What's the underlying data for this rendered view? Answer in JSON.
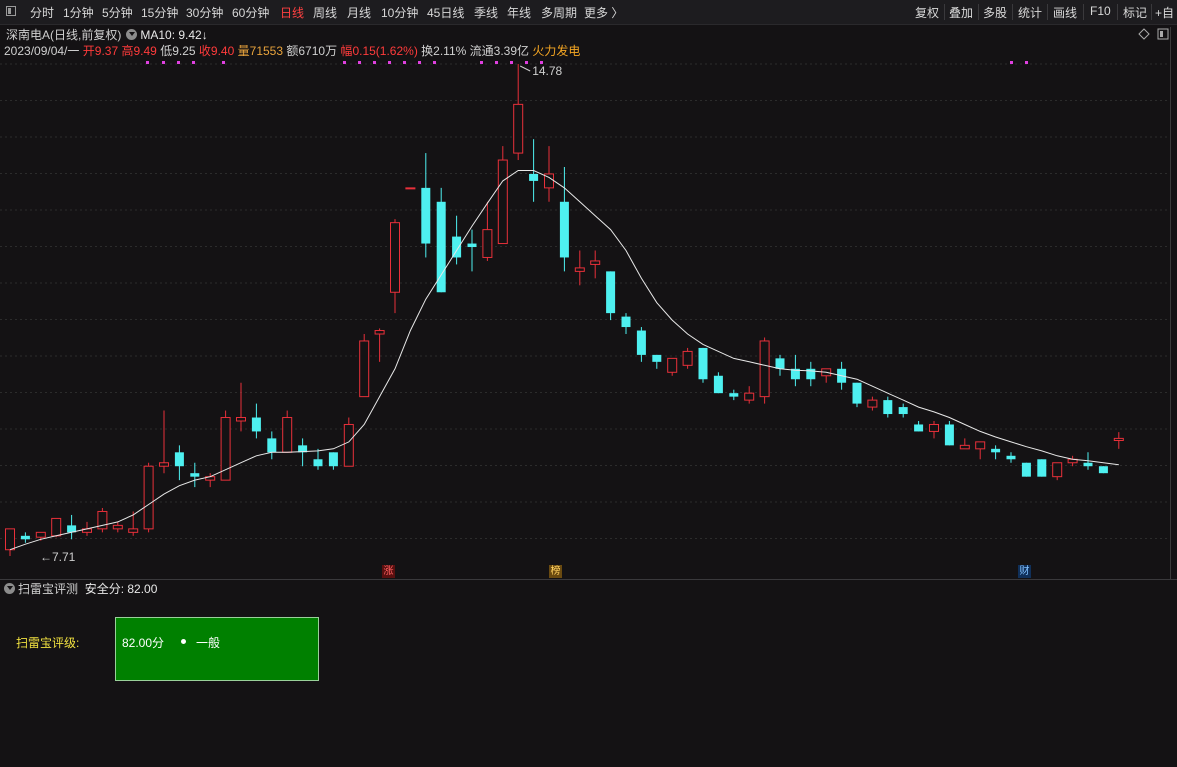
{
  "toolbar": {
    "periods": [
      "分时",
      "1分钟",
      "5分钟",
      "15分钟",
      "30分钟",
      "60分钟",
      "日线",
      "周线",
      "月线",
      "10分钟",
      "45日线",
      "季线",
      "年线",
      "多周期",
      "更多 〉"
    ],
    "active_period": "日线",
    "right_buttons": [
      "复权",
      "叠加",
      "多股",
      "统计",
      "画线",
      "F10",
      "标记",
      "+自"
    ]
  },
  "stock": {
    "name": "深南电A",
    "mode": "(日线,前复权)",
    "ma_label": "MA10:",
    "ma_value": "9.42",
    "ma_arrow": "↓",
    "date": "2023/09/04/一",
    "open_label": "开",
    "open": "9.37",
    "high_label": "高",
    "high": "9.49",
    "low_label": "低",
    "low": "9.25",
    "close_label": "收",
    "close": "9.40",
    "vol_label": "量",
    "vol": "71553",
    "amount_label": "额",
    "amount": "6710万",
    "range_label": "幅",
    "range": "0.15(1.62%)",
    "turnover_label": "换",
    "turnover": "2.11%",
    "float_label": "流通",
    "float_cap": "3.39亿",
    "sector": "火力发电"
  },
  "chart_data": {
    "type": "candlestick",
    "candles": [
      [
        7.8,
        8.1,
        7.71,
        8.05
      ],
      [
        8.0,
        7.95,
        7.9,
        8.05
      ],
      [
        7.98,
        8.05,
        7.93,
        8.0
      ],
      [
        8.0,
        8.25,
        7.98,
        8.18
      ],
      [
        8.15,
        8.05,
        7.95,
        8.3
      ],
      [
        8.05,
        8.1,
        8.0,
        8.2
      ],
      [
        8.1,
        8.35,
        8.05,
        8.4
      ],
      [
        8.1,
        8.15,
        8.05,
        8.2
      ],
      [
        8.05,
        8.1,
        8.0,
        8.35
      ],
      [
        8.1,
        9.0,
        8.05,
        9.05
      ],
      [
        9.0,
        9.05,
        8.9,
        9.8
      ],
      [
        9.2,
        9.0,
        8.8,
        9.3
      ],
      [
        8.9,
        8.85,
        8.7,
        9.05
      ],
      [
        8.8,
        8.85,
        8.7,
        8.9
      ],
      [
        8.8,
        9.7,
        8.8,
        9.8
      ],
      [
        9.65,
        9.7,
        9.5,
        10.2
      ],
      [
        9.7,
        9.5,
        9.4,
        9.9
      ],
      [
        9.4,
        9.2,
        9.1,
        9.5
      ],
      [
        9.2,
        9.7,
        9.2,
        9.8
      ],
      [
        9.3,
        9.2,
        9.0,
        9.4
      ],
      [
        9.1,
        9.0,
        8.95,
        9.25
      ],
      [
        9.2,
        9.0,
        8.95,
        9.2
      ],
      [
        9.0,
        9.6,
        9.0,
        9.7
      ],
      [
        10.0,
        10.8,
        10.0,
        10.9
      ],
      [
        10.9,
        10.95,
        10.5,
        10.98
      ],
      [
        11.5,
        12.5,
        11.2,
        12.55
      ],
      [
        13.0,
        13.0,
        13.0,
        13.0
      ],
      [
        13.0,
        12.2,
        12.0,
        13.5
      ],
      [
        12.8,
        11.5,
        11.5,
        13.0
      ],
      [
        12.3,
        12.0,
        11.9,
        12.6
      ],
      [
        12.2,
        12.15,
        11.8,
        12.4
      ],
      [
        12.0,
        12.4,
        11.95,
        12.8
      ],
      [
        12.2,
        13.4,
        12.2,
        13.6
      ],
      [
        13.5,
        14.2,
        13.4,
        14.78
      ],
      [
        13.2,
        13.1,
        12.8,
        13.7
      ],
      [
        13.0,
        13.2,
        12.8,
        13.6
      ],
      [
        12.8,
        12.0,
        11.8,
        13.3
      ],
      [
        11.8,
        11.85,
        11.6,
        12.1
      ],
      [
        11.9,
        11.95,
        11.7,
        12.1
      ],
      [
        11.8,
        11.2,
        11.1,
        11.8
      ],
      [
        11.15,
        11.0,
        10.9,
        11.2
      ],
      [
        10.95,
        10.6,
        10.5,
        11.0
      ],
      [
        10.6,
        10.5,
        10.4,
        10.6
      ],
      [
        10.35,
        10.55,
        10.3,
        10.55
      ],
      [
        10.45,
        10.65,
        10.4,
        10.7
      ],
      [
        10.7,
        10.25,
        10.2,
        10.7
      ],
      [
        10.3,
        10.05,
        10.05,
        10.35
      ],
      [
        10.05,
        10.0,
        9.95,
        10.1
      ],
      [
        9.95,
        10.05,
        9.9,
        10.15
      ],
      [
        10.0,
        10.8,
        9.9,
        10.85
      ],
      [
        10.55,
        10.4,
        10.3,
        10.6
      ],
      [
        10.4,
        10.25,
        10.15,
        10.6
      ],
      [
        10.4,
        10.25,
        10.15,
        10.5
      ],
      [
        10.3,
        10.4,
        10.2,
        10.4
      ],
      [
        10.4,
        10.2,
        10.1,
        10.5
      ],
      [
        10.2,
        9.9,
        9.85,
        10.2
      ],
      [
        9.85,
        9.95,
        9.8,
        10.0
      ],
      [
        9.95,
        9.75,
        9.7,
        10.0
      ],
      [
        9.85,
        9.75,
        9.7,
        9.9
      ],
      [
        9.6,
        9.5,
        9.5,
        9.65
      ],
      [
        9.5,
        9.6,
        9.4,
        9.65
      ],
      [
        9.6,
        9.3,
        9.3,
        9.65
      ],
      [
        9.25,
        9.3,
        9.25,
        9.4
      ],
      [
        9.25,
        9.35,
        9.1,
        9.35
      ],
      [
        9.25,
        9.2,
        9.1,
        9.3
      ],
      [
        9.15,
        9.1,
        9.05,
        9.2
      ],
      [
        9.05,
        8.85,
        8.85,
        9.05
      ],
      [
        9.1,
        8.85,
        8.85,
        9.1
      ],
      [
        8.85,
        9.05,
        8.8,
        9.05
      ],
      [
        9.05,
        9.1,
        9.0,
        9.15
      ],
      [
        9.05,
        9.0,
        8.95,
        9.2
      ],
      [
        9.0,
        8.9,
        8.9,
        9.0
      ],
      [
        9.37,
        9.4,
        9.25,
        9.49
      ]
    ],
    "ma10": [
      7.8,
      7.88,
      7.95,
      8.0,
      8.05,
      8.1,
      8.15,
      8.2,
      8.3,
      8.45,
      8.6,
      8.72,
      8.8,
      8.85,
      8.95,
      9.05,
      9.15,
      9.2,
      9.2,
      9.21,
      9.22,
      9.25,
      9.35,
      9.6,
      10.0,
      10.4,
      10.95,
      11.4,
      11.75,
      12.1,
      12.45,
      12.78,
      13.1,
      13.25,
      13.25,
      13.15,
      13.0,
      12.8,
      12.6,
      12.4,
      12.1,
      11.7,
      11.35,
      11.1,
      10.9,
      10.75,
      10.65,
      10.55,
      10.5,
      10.45,
      10.4,
      10.38,
      10.37,
      10.35,
      10.3,
      10.25,
      10.15,
      10.05,
      9.95,
      9.85,
      9.78,
      9.7,
      9.6,
      9.5,
      9.42,
      9.35,
      9.28,
      9.22,
      9.15,
      9.1,
      9.08,
      9.05,
      9.02
    ],
    "high_mark": "14.78",
    "low_mark": "7.71",
    "event_markers": [
      "涨",
      "榜",
      "财"
    ]
  },
  "panel": {
    "title": "扫雷宝评测",
    "score_label": "安全分:",
    "score": "82.00",
    "rating_label": "扫雷宝评级:",
    "rating_score": "82.00分",
    "rating_level": "一般",
    "rating_color": "#008000"
  },
  "colors": {
    "up": "#e8303a",
    "down": "#4ef0f0",
    "ma": "#e8e8e8",
    "background": "#141214"
  }
}
